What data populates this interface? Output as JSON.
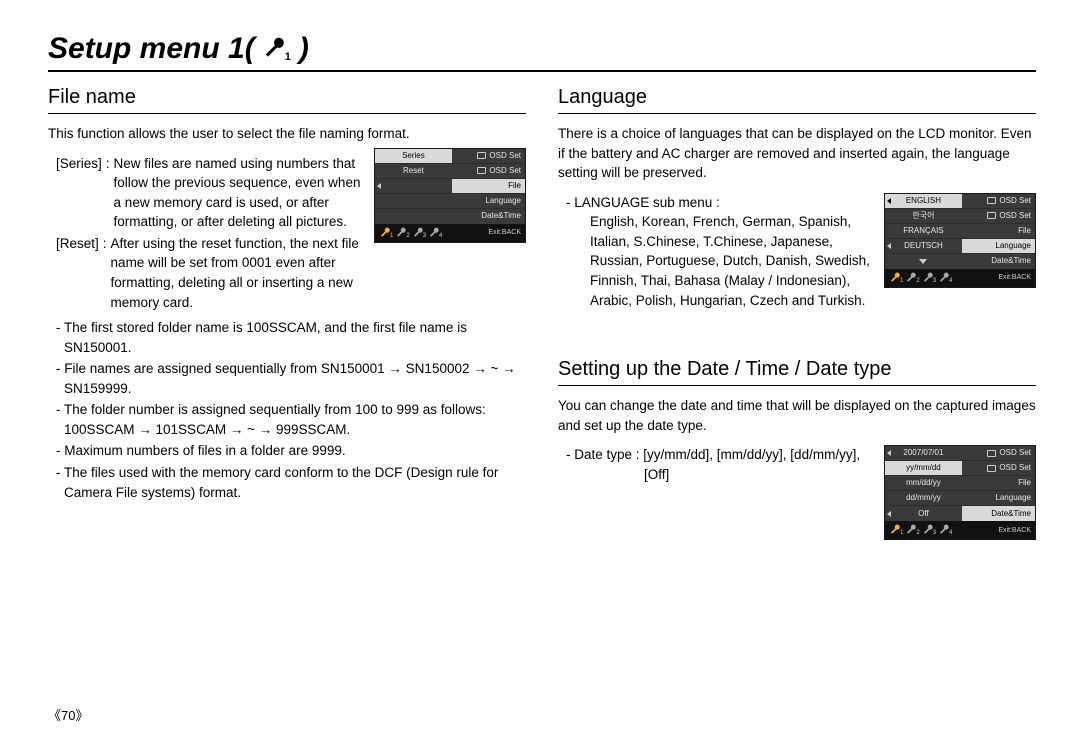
{
  "page_title_prefix": "Setup menu 1(",
  "page_title_suffix": ")",
  "page_number": "《70》",
  "left": {
    "h": "File name",
    "intro": "This function allows the user to select the file naming format.",
    "defs": [
      {
        "label": "[Series]",
        "text": "New files are named using numbers that follow the previous sequence, even when a new memory card is used, or after formatting, or after deleting all pictures."
      },
      {
        "label": "[Reset]",
        "text": "After using the reset function, the next file name will be set from 0001 even after formatting, deleting all or inserting a new memory card."
      }
    ],
    "bullets": [
      "The first stored folder name is 100SSCAM, and the first file name is SN150001.",
      "File names are assigned sequentially from SN150001 → SN150002 → ~ → SN159999.",
      "The folder number is assigned sequentially from 100 to 999 as follows: 100SSCAM → 101SSCAM → ~ → 999SSCAM.",
      "Maximum numbers of files in a folder are 9999.",
      "The files used with the memory card conform to the DCF (Design rule for Camera File systems) format."
    ],
    "osd": {
      "left_items": [
        {
          "text": "Series",
          "sel": true,
          "arrow": false,
          "center": true
        },
        {
          "text": "Reset",
          "sel": false,
          "arrow": false,
          "center": true
        },
        {
          "text": "",
          "sel": false,
          "arrow": true,
          "center": false
        },
        {
          "text": "",
          "sel": false,
          "arrow": false,
          "center": false
        },
        {
          "text": "",
          "sel": false,
          "arrow": false,
          "center": false
        }
      ],
      "right_items": [
        {
          "icon": "cam",
          "text": "OSD Set"
        },
        {
          "icon": "play",
          "text": "OSD Set"
        },
        {
          "icon": "",
          "text": "File",
          "sel": true
        },
        {
          "icon": "",
          "text": "Language"
        },
        {
          "icon": "",
          "text": "Date&Time"
        }
      ],
      "active_tool": 1,
      "exit": "Exit:BACK"
    }
  },
  "right": {
    "lang": {
      "h": "Language",
      "intro": "There is a choice of languages that can be displayed on the LCD monitor. Even if the battery and AC charger are removed and inserted again, the language setting will be preserved.",
      "sub_label": "- LANGUAGE sub menu :",
      "langs": "English, Korean, French, German, Spanish, Italian, S.Chinese, T.Chinese, Japanese, Russian, Portuguese, Dutch, Danish, Swedish, Finnish, Thai, Bahasa (Malay / Indonesian), Arabic, Polish, Hungarian, Czech and Turkish.",
      "osd": {
        "left_items": [
          {
            "text": "ENGLISH",
            "sel": true,
            "arrow": true,
            "center": true
          },
          {
            "text": "한국어",
            "sel": false,
            "arrow": false,
            "center": true
          },
          {
            "text": "FRANÇAIS",
            "sel": false,
            "arrow": false,
            "center": true
          },
          {
            "text": "DEUTSCH",
            "sel": false,
            "arrow": true,
            "center": true
          },
          {
            "text": "",
            "sel": false,
            "arrow": false,
            "center": true,
            "down": true
          }
        ],
        "right_items": [
          {
            "icon": "cam",
            "text": "OSD Set"
          },
          {
            "icon": "play",
            "text": "OSD Set"
          },
          {
            "icon": "",
            "text": "File"
          },
          {
            "icon": "",
            "text": "Language",
            "sel": true
          },
          {
            "icon": "",
            "text": "Date&Time"
          }
        ],
        "active_tool": 1,
        "exit": "Exit:BACK"
      }
    },
    "date": {
      "h": "Setting up the Date / Time / Date type",
      "intro": "You can change the date and time that will be displayed on the captured images and set up the date type.",
      "line1": "- Date type : [yy/mm/dd], [mm/dd/yy], [dd/mm/yy],",
      "line2": "[Off]",
      "osd": {
        "left_items": [
          {
            "text": "2007/07/01",
            "sel": false,
            "arrow": true,
            "center": true
          },
          {
            "text": "yy/mm/dd",
            "sel": true,
            "arrow": false,
            "center": true
          },
          {
            "text": "mm/dd/yy",
            "sel": false,
            "arrow": false,
            "center": true
          },
          {
            "text": "dd/mm/yy",
            "sel": false,
            "arrow": false,
            "center": true
          },
          {
            "text": "Off",
            "sel": false,
            "arrow": true,
            "center": true
          }
        ],
        "right_items": [
          {
            "icon": "cam",
            "text": "OSD Set"
          },
          {
            "icon": "play",
            "text": "OSD Set"
          },
          {
            "icon": "",
            "text": "File"
          },
          {
            "icon": "",
            "text": "Language"
          },
          {
            "icon": "",
            "text": "Date&Time",
            "sel": true
          }
        ],
        "active_tool": 1,
        "exit": "Exit:BACK"
      }
    }
  }
}
